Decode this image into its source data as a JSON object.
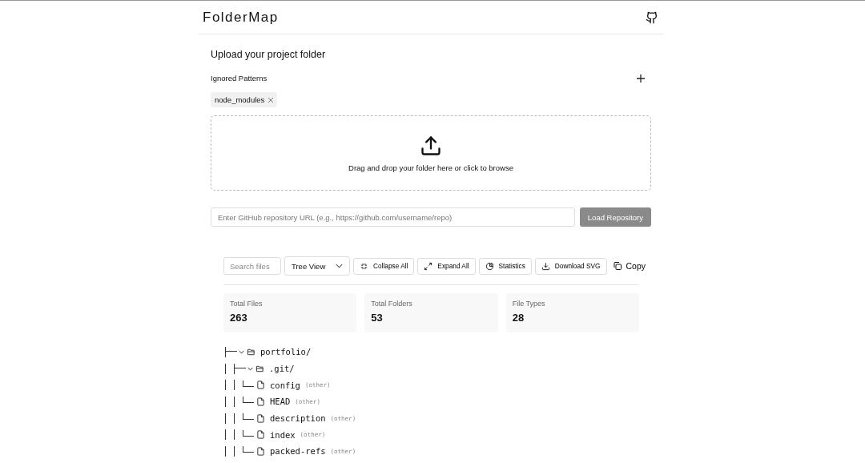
{
  "header": {
    "title": "FolderMap"
  },
  "upload": {
    "title": "Upload your project folder",
    "ignored_label": "Ignored Patterns",
    "patterns": [
      "node_modules"
    ],
    "dropzone_text": "Drag and drop your folder here or click to browse"
  },
  "repo": {
    "placeholder": "Enter GitHub repository URL (e.g., https://github.com/username/repo)",
    "button": "Load Repository",
    "disabled": true
  },
  "toolbar": {
    "search_placeholder": "Search files",
    "view": "Tree View",
    "buttons": [
      {
        "kind": "collapse",
        "label": "Collapse All"
      },
      {
        "kind": "expand",
        "label": "Expand All"
      },
      {
        "kind": "stats",
        "label": "Statistics"
      },
      {
        "kind": "download",
        "label": "Download SVG"
      }
    ],
    "copy": "Copy"
  },
  "stats": [
    {
      "label": "Total Files",
      "value": "263"
    },
    {
      "label": "Total Folders",
      "value": "53"
    },
    {
      "label": "File Types",
      "value": "28"
    }
  ],
  "tree": [
    {
      "name": "portfolio/",
      "kind": "folder",
      "last": false,
      "expanded": true,
      "children": [
        {
          "name": ".git/",
          "kind": "folder",
          "last": false,
          "expanded": true,
          "children": [
            {
              "name": "config",
              "kind": "file",
              "last": true,
              "tag": "(other)"
            },
            {
              "name": "HEAD",
              "kind": "file",
              "last": true,
              "tag": "(other)"
            },
            {
              "name": "description",
              "kind": "file",
              "last": true,
              "tag": "(other)"
            },
            {
              "name": "index",
              "kind": "file",
              "last": true,
              "tag": "(other)"
            },
            {
              "name": "packed-refs",
              "kind": "file",
              "last": true,
              "tag": "(other)"
            }
          ]
        }
      ]
    }
  ]
}
